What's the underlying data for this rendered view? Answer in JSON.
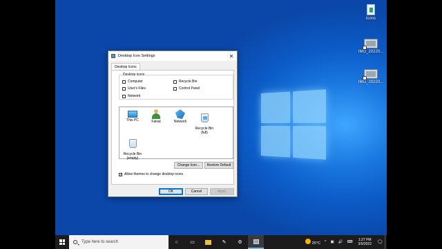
{
  "dialog": {
    "title": "Desktop Icon Settings",
    "close_glyph": "✕",
    "tab": "Desktop Icons",
    "group_label": "Desktop icons",
    "checkboxes": [
      {
        "label": "Computer",
        "checked": false
      },
      {
        "label": "Recycle Bin",
        "checked": false
      },
      {
        "label": "User's Files",
        "checked": false
      },
      {
        "label": "Control Panel",
        "checked": false
      },
      {
        "label": "Network",
        "checked": false
      }
    ],
    "icons": [
      {
        "label": "This PC",
        "icon": "monitor-icon"
      },
      {
        "label": "Faisal",
        "icon": "user-folder-icon"
      },
      {
        "label": "Network",
        "icon": "network-icon"
      },
      {
        "label": "Recycle Bin\n(full)",
        "icon": "recycle-bin-full-icon"
      },
      {
        "label": "Recycle Bin\n(empty)",
        "icon": "recycle-bin-empty-icon"
      }
    ],
    "change_icon_label": "Change Icon...",
    "restore_default_label": "Restore Default",
    "allow_themes_label": "Allow themes to change desktop icons",
    "allow_themes_checked": true,
    "ok_label": "OK",
    "cancel_label": "Cancel",
    "apply_label": "Apply"
  },
  "desktop_icons": [
    {
      "label": "icons",
      "icon": "file-icon"
    },
    {
      "label": "IMG_20220...",
      "icon": "image-shortcut-icon"
    },
    {
      "label": "IMG_20220...",
      "icon": "image-shortcut-icon"
    }
  ],
  "taskbar": {
    "search_placeholder": "Type here to search",
    "weather": "25°C",
    "time": "1:27 PM",
    "date": "3/5/2022",
    "tray_glyphs": {
      "chevron": "^",
      "volume": "🔊",
      "notification": "🗨"
    }
  }
}
